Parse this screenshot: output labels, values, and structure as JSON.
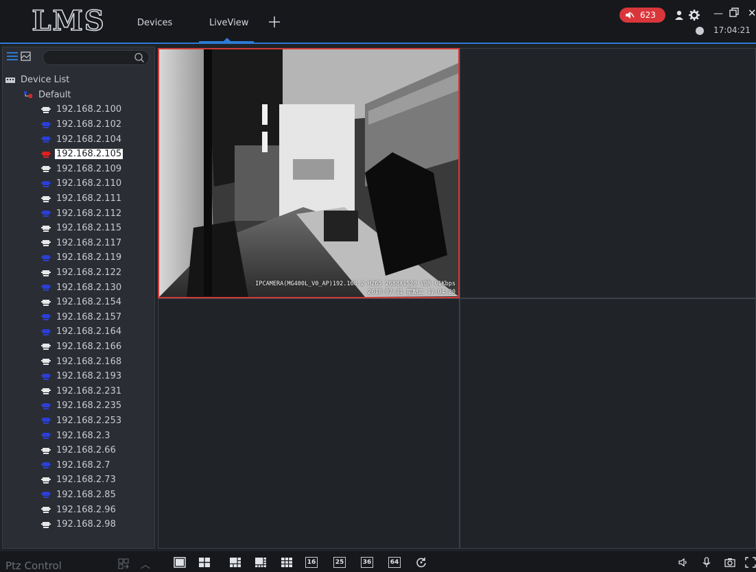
{
  "app": {
    "logo_text": "LMS"
  },
  "header": {
    "tabs": [
      {
        "label": "Devices"
      },
      {
        "label": "LiveView"
      }
    ],
    "active_tab": "LiveView",
    "alarm_count": "623",
    "clock": "17:04:21"
  },
  "sidebar": {
    "search_placeholder": "",
    "root_label": "Device List",
    "group_label": "Default",
    "selected_device": "192.168.2.105",
    "devices": [
      {
        "ip": "192.168.2.100",
        "status": "white"
      },
      {
        "ip": "192.168.2.102",
        "status": "blue"
      },
      {
        "ip": "192.168.2.104",
        "status": "blue"
      },
      {
        "ip": "192.168.2.105",
        "status": "red"
      },
      {
        "ip": "192.168.2.109",
        "status": "white"
      },
      {
        "ip": "192.168.2.110",
        "status": "blue"
      },
      {
        "ip": "192.168.2.111",
        "status": "white"
      },
      {
        "ip": "192.168.2.112",
        "status": "blue"
      },
      {
        "ip": "192.168.2.115",
        "status": "white"
      },
      {
        "ip": "192.168.2.117",
        "status": "white"
      },
      {
        "ip": "192.168.2.119",
        "status": "blue"
      },
      {
        "ip": "192.168.2.122",
        "status": "white"
      },
      {
        "ip": "192.168.2.130",
        "status": "blue"
      },
      {
        "ip": "192.168.2.154",
        "status": "white"
      },
      {
        "ip": "192.168.2.157",
        "status": "blue"
      },
      {
        "ip": "192.168.2.164",
        "status": "blue"
      },
      {
        "ip": "192.168.2.166",
        "status": "white"
      },
      {
        "ip": "192.168.2.168",
        "status": "white"
      },
      {
        "ip": "192.168.2.193",
        "status": "blue"
      },
      {
        "ip": "192.168.2.231",
        "status": "white"
      },
      {
        "ip": "192.168.2.235",
        "status": "blue"
      },
      {
        "ip": "192.168.2.253",
        "status": "blue"
      },
      {
        "ip": "192.168.2.3",
        "status": "blue"
      },
      {
        "ip": "192.168.2.66",
        "status": "white"
      },
      {
        "ip": "192.168.2.7",
        "status": "blue"
      },
      {
        "ip": "192.168.2.73",
        "status": "white"
      },
      {
        "ip": "192.168.2.85",
        "status": "blue"
      },
      {
        "ip": "192.168.2.96",
        "status": "white"
      },
      {
        "ip": "192.168.2.98",
        "status": "white"
      }
    ]
  },
  "liveview": {
    "overlay_line1": "IPCAMERA(MG400L_V0_AP)192.168.2 H265 2688X1520 VBR 61Kbps",
    "overlay_line2": "2018-07-31 星期二 17:04:20"
  },
  "footer": {
    "ptz_label": "Ptz Control",
    "layout_buttons": [
      "16",
      "25",
      "36",
      "64"
    ]
  },
  "colors": {
    "accent": "#2d7bd6",
    "alarm": "#d9363b",
    "device_online_blue": "#2b3fd6",
    "device_alarm_red": "#e02020",
    "active_border": "#d23a3a"
  }
}
